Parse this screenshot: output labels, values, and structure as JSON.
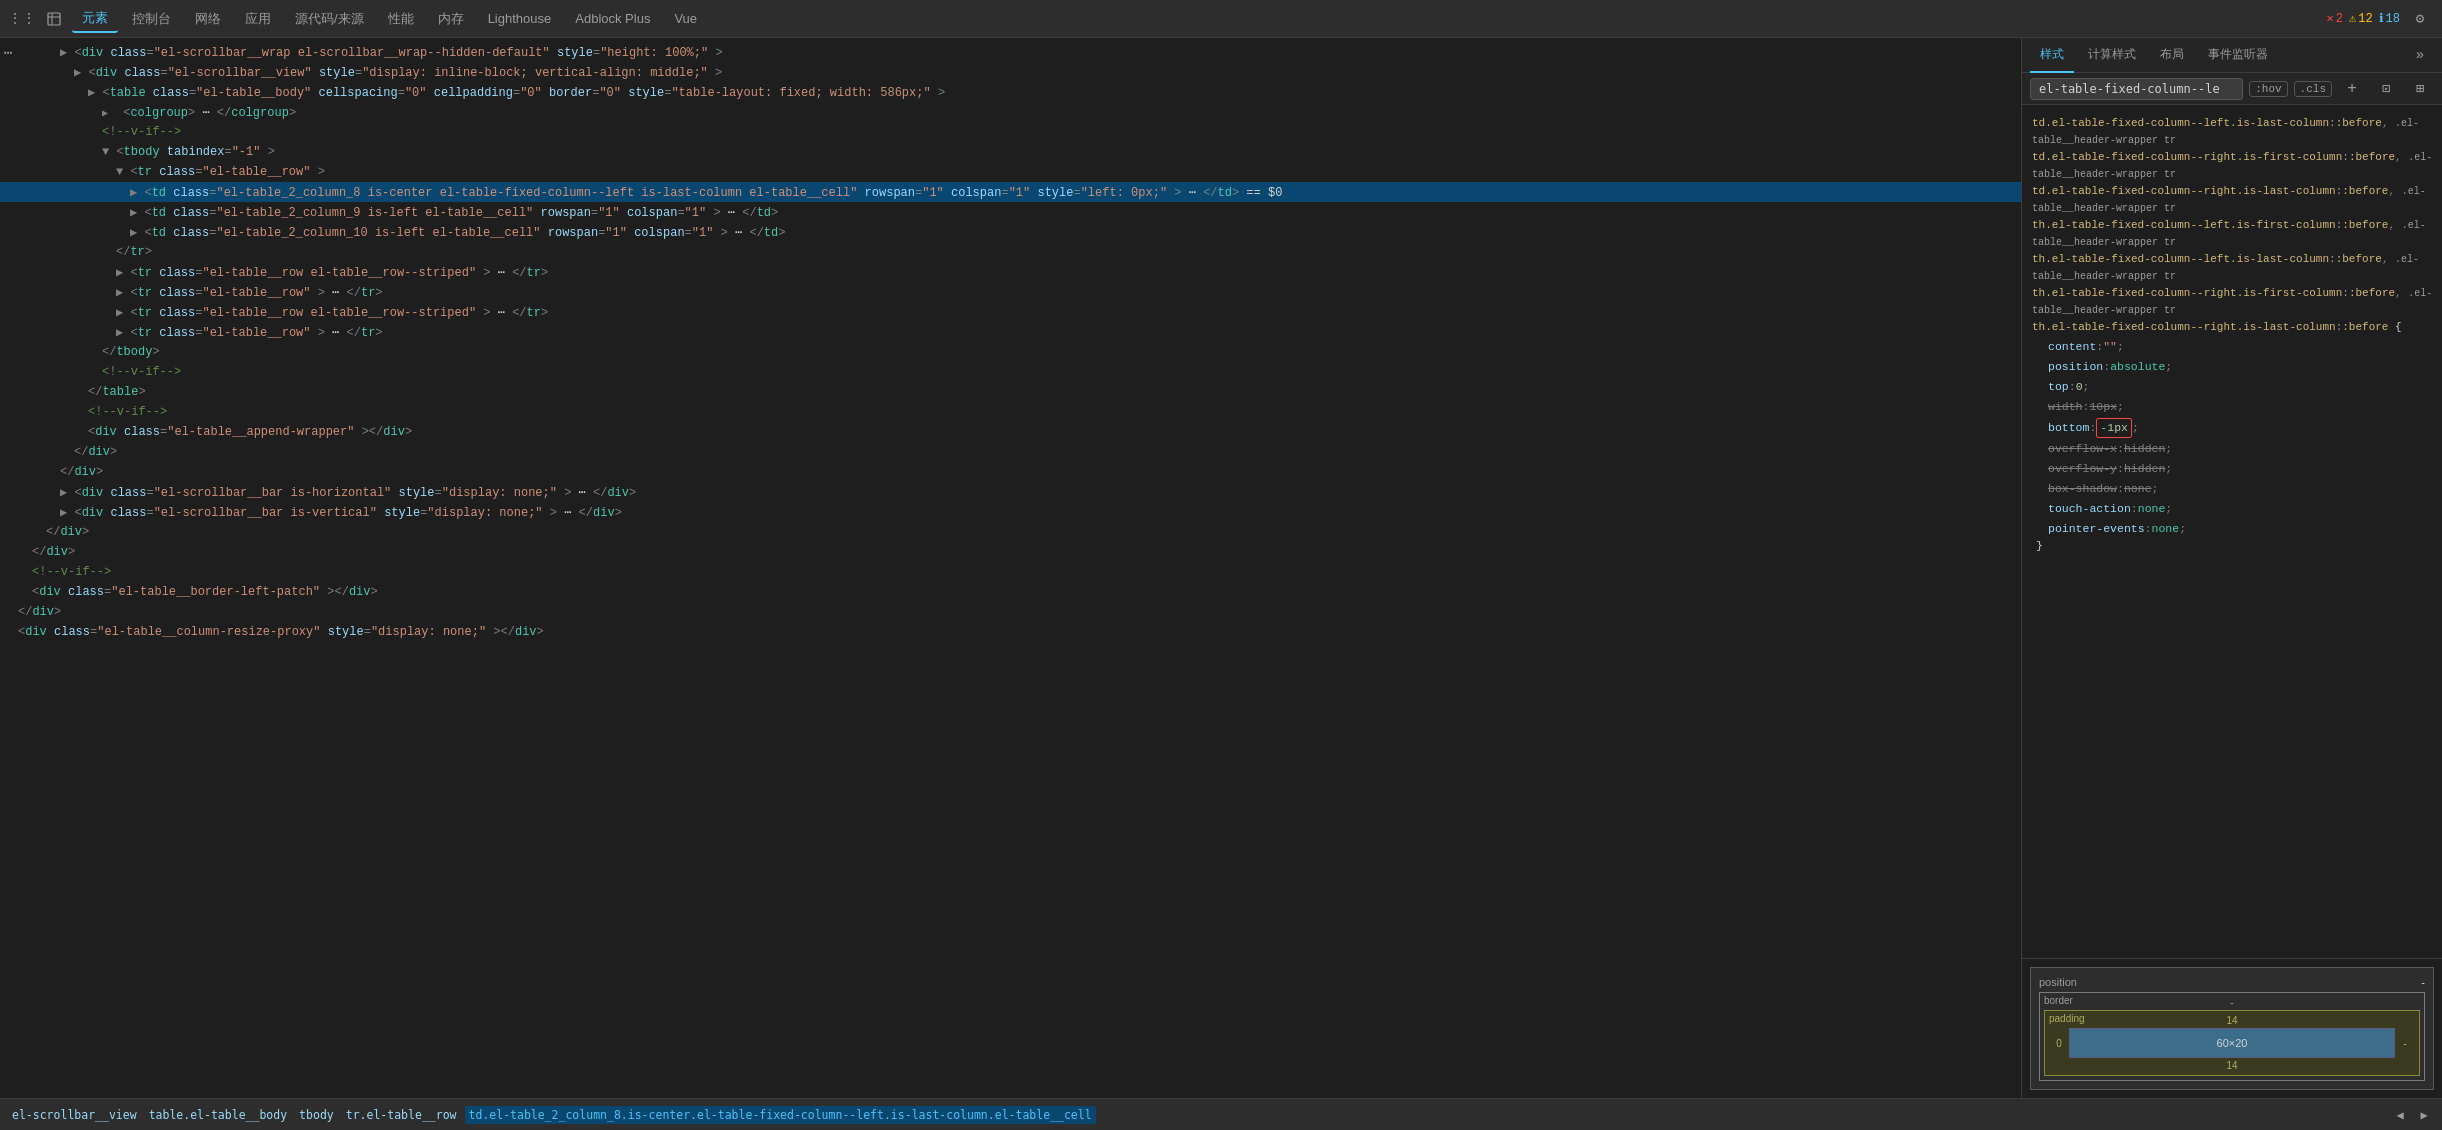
{
  "toolbar": {
    "icons": [
      "⊞",
      "☰"
    ],
    "tabs": [
      {
        "label": "元素",
        "active": true
      },
      {
        "label": "控制台",
        "active": false
      },
      {
        "label": "网络",
        "active": false
      },
      {
        "label": "应用",
        "active": false
      },
      {
        "label": "源代码/来源",
        "active": false
      },
      {
        "label": "性能",
        "active": false
      },
      {
        "label": "内存",
        "active": false
      },
      {
        "label": "Lighthouse",
        "active": false
      },
      {
        "label": "Adblock Plus",
        "active": false
      },
      {
        "label": "Vue",
        "active": false
      }
    ],
    "badge_error": "2",
    "badge_warning": "12",
    "badge_info": "18"
  },
  "dom_lines": [
    {
      "indent": 0,
      "html": "<span class='tag-bracket'>▶</span><span class='tag-bracket'>&lt;</span><span class='tag-name'>div</span> <span class='attr-name'>class</span><span class='tag-bracket'>=</span><span class='attr-value'>\"el-scrollbar__wrap el-scrollbar__wrap--hidden-default\"</span> <span class='attr-name'>style</span><span class='tag-bracket'>=</span><span class='attr-value'>\"height: 100%;\"</span> <span class='tag-bracket'>&gt;</span>",
      "depth": 4
    },
    {
      "indent": 1,
      "html": "<span class='tag-bracket'>▶</span><span class='tag-bracket'>&lt;</span><span class='tag-name'>div</span> <span class='attr-name'>class</span><span class='tag-bracket'>=</span><span class='attr-value'>\"el-scrollbar__view\"</span> <span class='attr-name'>style</span><span class='tag-bracket'>=</span><span class='attr-value'>\"display: inline-block; vertical-align: middle;\"</span><span class='tag-bracket'>&gt;</span>",
      "depth": 5
    },
    {
      "indent": 2,
      "html": "<span class='tag-bracket'>▶</span><span class='tag-bracket'>&lt;</span><span class='tag-name'>table</span> <span class='attr-name'>class</span><span class='tag-bracket'>=</span><span class='attr-value'>\"el-table__body\"</span> <span class='attr-name'>cellspacing</span><span class='tag-bracket'>=</span><span class='attr-value'>\"0\"</span> <span class='attr-name'>cellpadding</span><span class='tag-bracket'>=</span><span class='attr-value'>\"0\"</span> <span class='attr-name'>border</span><span class='tag-bracket'>=</span><span class='attr-value'>\"0\"</span> <span class='attr-name'>style</span><span class='tag-bracket'>=</span><span class='attr-value'>\"table-layout: fixed; width: 586px;\"</span><span class='tag-bracket'>&gt;</span>",
      "depth": 6
    },
    {
      "indent": 3,
      "html": "<span class='expand-arrow'>▶</span><span class='tag-bracket'>&lt;</span><span class='tag-name'>colgroup</span><span class='tag-bracket'>&gt;</span><span class='text-node'>⋯</span><span class='tag-bracket'>&lt;/</span><span class='tag-name'>colgroup</span><span class='tag-bracket'>&gt;</span>",
      "depth": 7
    },
    {
      "indent": 3,
      "html": "<span class='comment'>&lt;!--v-if--&gt;</span>",
      "depth": 7
    },
    {
      "indent": 3,
      "html": "<span class='tag-bracket'>▼</span><span class='tag-bracket'>&lt;</span><span class='tag-name'>tbody</span> <span class='attr-name'>tabindex</span><span class='tag-bracket'>=</span><span class='attr-value'>\"-1\"</span><span class='tag-bracket'>&gt;</span>",
      "depth": 7
    },
    {
      "indent": 4,
      "html": "<span class='tag-bracket'>▼</span><span class='tag-bracket'>&lt;</span><span class='tag-name'>tr</span> <span class='attr-name'>class</span><span class='tag-bracket'>=</span><span class='attr-value'>\"el-table__row\"</span><span class='tag-bracket'>&gt;</span>",
      "depth": 8
    },
    {
      "indent": 5,
      "html": "<span class='tag-bracket'>▶</span><span class='tag-bracket'>&lt;</span><span class='tag-name'>td</span> <span class='attr-name'>class</span><span class='tag-bracket'>=</span><span class='attr-value'>\"el-table_2_column_8 is-center el-table-fixed-column--left is-last-column el-table__cell\"</span> <span class='attr-name'>rowspan</span><span class='tag-bracket'>=</span><span class='attr-value'>\"1\"</span> <span class='attr-name'>colspan</span><span class='tag-bracket'>=</span><span class='attr-value'>\"1\"</span> <span class='attr-name'>style</span><span class='tag-bracket'>=</span><span class='attr-value'>\"left: 0px;\"</span><span class='tag-bracket'>&gt;</span><span class='text-node'>⋯</span><span class='tag-bracket'>&lt;/</span><span class='tag-name'>td</span><span class='tag-bracket'>&gt;</span> <span class='text-node'>== $0</span>",
      "depth": 9,
      "selected": true
    },
    {
      "indent": 5,
      "html": "<span class='tag-bracket'>▶</span><span class='tag-bracket'>&lt;</span><span class='tag-name'>td</span> <span class='attr-name'>class</span><span class='tag-bracket'>=</span><span class='attr-value'>\"el-table_2_column_9 is-left el-table__cell\"</span> <span class='attr-name'>rowspan</span><span class='tag-bracket'>=</span><span class='attr-value'>\"1\"</span> <span class='attr-name'>colspan</span><span class='tag-bracket'>=</span><span class='attr-value'>\"1\"</span><span class='tag-bracket'>&gt;</span><span class='text-node'>⋯</span><span class='tag-bracket'>&lt;/</span><span class='tag-name'>td</span><span class='tag-bracket'>&gt;</span>",
      "depth": 9
    },
    {
      "indent": 5,
      "html": "<span class='tag-bracket'>▶</span><span class='tag-bracket'>&lt;</span><span class='tag-name'>td</span> <span class='attr-name'>class</span><span class='tag-bracket'>=</span><span class='attr-value'>\"el-table_2_column_10 is-left el-table__cell\"</span> <span class='attr-name'>rowspan</span><span class='tag-bracket'>=</span><span class='attr-value'>\"1\"</span> <span class='attr-name'>colspan</span><span class='tag-bracket'>=</span><span class='attr-value'>\"1\"</span><span class='tag-bracket'>&gt;</span><span class='text-node'>⋯</span><span class='tag-bracket'>&lt;/</span><span class='tag-name'>td</span><span class='tag-bracket'>&gt;</span>",
      "depth": 9
    },
    {
      "indent": 4,
      "html": "<span class='tag-bracket'>&lt;/</span><span class='tag-name'>tr</span><span class='tag-bracket'>&gt;</span>",
      "depth": 8
    },
    {
      "indent": 4,
      "html": "<span class='tag-bracket'>▶</span><span class='tag-bracket'>&lt;</span><span class='tag-name'>tr</span> <span class='attr-name'>class</span><span class='tag-bracket'>=</span><span class='attr-value'>\"el-table__row el-table__row--striped\"</span><span class='tag-bracket'>&gt;</span><span class='text-node'>⋯</span><span class='tag-bracket'>&lt;/</span><span class='tag-name'>tr</span><span class='tag-bracket'>&gt;</span>",
      "depth": 8
    },
    {
      "indent": 4,
      "html": "<span class='tag-bracket'>▶</span><span class='tag-bracket'>&lt;</span><span class='tag-name'>tr</span> <span class='attr-name'>class</span><span class='tag-bracket'>=</span><span class='attr-value'>\"el-table__row\"</span><span class='tag-bracket'>&gt;</span><span class='text-node'>⋯</span><span class='tag-bracket'>&lt;/</span><span class='tag-name'>tr</span><span class='tag-bracket'>&gt;</span>",
      "depth": 8
    },
    {
      "indent": 4,
      "html": "<span class='tag-bracket'>▶</span><span class='tag-bracket'>&lt;</span><span class='tag-name'>tr</span> <span class='attr-name'>class</span><span class='tag-bracket'>=</span><span class='attr-value'>\"el-table__row el-table__row--striped\"</span><span class='tag-bracket'>&gt;</span><span class='text-node'>⋯</span><span class='tag-bracket'>&lt;/</span><span class='tag-name'>tr</span><span class='tag-bracket'>&gt;</span>",
      "depth": 8
    },
    {
      "indent": 4,
      "html": "<span class='tag-bracket'>▶</span><span class='tag-bracket'>&lt;</span><span class='tag-name'>tr</span> <span class='attr-name'>class</span><span class='tag-bracket'>=</span><span class='attr-value'>\"el-table__row\"</span><span class='tag-bracket'>&gt;</span><span class='text-node'>⋯</span><span class='tag-bracket'>&lt;/</span><span class='tag-name'>tr</span><span class='tag-bracket'>&gt;</span>",
      "depth": 8
    },
    {
      "indent": 3,
      "html": "<span class='tag-bracket'>&lt;/</span><span class='tag-name'>tbody</span><span class='tag-bracket'>&gt;</span>",
      "depth": 7
    },
    {
      "indent": 3,
      "html": "<span class='comment'>&lt;!--v-if--&gt;</span>",
      "depth": 7
    },
    {
      "indent": 2,
      "html": "<span class='tag-bracket'>&lt;/</span><span class='tag-name'>table</span><span class='tag-bracket'>&gt;</span>",
      "depth": 6
    },
    {
      "indent": 2,
      "html": "<span class='comment'>&lt;!--v-if--&gt;</span>",
      "depth": 6
    },
    {
      "indent": 2,
      "html": "<span class='tag-bracket'>&lt;</span><span class='tag-name'>div</span> <span class='attr-name'>class</span><span class='tag-bracket'>=</span><span class='attr-value'>\"el-table__append-wrapper\"</span><span class='tag-bracket'>&gt;&lt;/</span><span class='tag-name'>div</span><span class='tag-bracket'>&gt;</span>",
      "depth": 6
    },
    {
      "indent": 1,
      "html": "<span class='tag-bracket'>&lt;/</span><span class='tag-name'>div</span><span class='tag-bracket'>&gt;</span>",
      "depth": 5
    },
    {
      "indent": 0,
      "html": "<span class='tag-bracket'>&lt;/</span><span class='tag-name'>div</span><span class='tag-bracket'>&gt;</span>",
      "depth": 4
    },
    {
      "indent": 0,
      "html": "<span class='tag-bracket'>▶</span><span class='tag-bracket'>&lt;</span><span class='tag-name'>div</span> <span class='attr-name'>class</span><span class='tag-bracket'>=</span><span class='attr-value'>\"el-scrollbar__bar is-horizontal\"</span> <span class='attr-name'>style</span><span class='tag-bracket'>=</span><span class='attr-value'>\"display: none;\"</span><span class='tag-bracket'>&gt;</span><span class='text-node'>⋯</span><span class='tag-bracket'>&lt;/</span><span class='tag-name'>div</span><span class='tag-bracket'>&gt;</span>",
      "depth": 4
    },
    {
      "indent": 0,
      "html": "<span class='tag-bracket'>▶</span><span class='tag-bracket'>&lt;</span><span class='tag-name'>div</span> <span class='attr-name'>class</span><span class='tag-bracket'>=</span><span class='attr-value'>\"el-scrollbar__bar is-vertical\"</span> <span class='attr-name'>style</span><span class='tag-bracket'>=</span><span class='attr-value'>\"display: none;\"</span><span class='tag-bracket'>&gt;</span><span class='text-node'>⋯</span><span class='tag-bracket'>&lt;/</span><span class='tag-name'>div</span><span class='tag-bracket'>&gt;</span>",
      "depth": 4
    },
    {
      "indent": -1,
      "html": "<span class='tag-bracket'>&lt;/</span><span class='tag-name'>div</span><span class='tag-bracket'>&gt;</span>",
      "depth": 3
    },
    {
      "indent": -2,
      "html": "<span class='tag-bracket'>&lt;/</span><span class='tag-name'>div</span><span class='tag-bracket'>&gt;</span>",
      "depth": 2
    },
    {
      "indent": -2,
      "html": "<span class='comment'>&lt;!--v-if--&gt;</span>",
      "depth": 2
    },
    {
      "indent": -2,
      "html": "<span class='tag-bracket'>&lt;</span><span class='tag-name'>div</span> <span class='attr-name'>class</span><span class='tag-bracket'>=</span><span class='attr-value'>\"el-table__border-left-patch\"</span><span class='tag-bracket'>&gt;&lt;/</span><span class='tag-name'>div</span><span class='tag-bracket'>&gt;</span>",
      "depth": 2
    },
    {
      "indent": -3,
      "html": "<span class='tag-bracket'>&lt;/</span><span class='tag-name'>div</span><span class='tag-bracket'>&gt;</span>",
      "depth": 1
    },
    {
      "indent": -3,
      "html": "<span class='tag-bracket'>&lt;</span><span class='tag-name'>div</span> <span class='attr-name'>class</span><span class='tag-bracket'>=</span><span class='attr-value'>\"el-table__column-resize-proxy\"</span> <span class='attr-name'>style</span><span class='tag-bracket'>=</span><span class='attr-value'>\"display: none;\"</span><span class='tag-bracket'>&gt;&lt;/</span><span class='tag-name'>div</span><span class='tag-bracket'>&gt;</span>",
      "depth": 1
    }
  ],
  "styles_panel": {
    "tabs": [
      "样式",
      "计算样式",
      "布局",
      "事件监听器"
    ],
    "more_icon": "»",
    "filter_value": "el-table-fixed-column--le",
    "filter_badges": [
      ":hov",
      ".cls"
    ],
    "add_icon": "+",
    "toggle_icon": "⊡",
    "expand_icon": "⊞",
    "selectors": [
      {
        "selector": "td.el-table-fixed-column--left.is-last-column::before,",
        "selector2": ".el-table__header-wrapper tr",
        "selector3": "td.el-table-fixed-column--right.is-first-column::before,",
        "selector4": ".el-table__header-wrapper tr",
        "selector5": "td.el-table-fixed-column--right.is-last-column::before,",
        "selector6": ".el-table__header-wrapper tr",
        "selector7": "th.el-table-fixed-column--left.is-first-column::before,",
        "selector8": ".el-table__header-wrapper tr",
        "selector9": "th.el-table-fixed-column--left.is-last-column::before,",
        "selector10": ".el-table__header-wrapper tr",
        "selector11": "th.el-table-fixed-column--right.is-first-column::before,",
        "selector12": ".el-table__header-wrapper tr",
        "selector13": "th.el-table-fixed-column--right.is-last-column::before {",
        "properties": [
          {
            "prop": "content",
            "val": "\"\"",
            "strikethrough": false
          },
          {
            "prop": "position",
            "val": "absolute",
            "strikethrough": false
          },
          {
            "prop": "top",
            "val": "0",
            "strikethrough": false
          },
          {
            "prop": "width",
            "val": "10px",
            "strikethrough": true
          },
          {
            "prop": "bottom",
            "val": "-1px",
            "strikethrough": false,
            "highlighted": true
          },
          {
            "prop": "overflow-x",
            "val": "hidden",
            "strikethrough": true
          },
          {
            "prop": "overflow-y",
            "val": "hidden",
            "strikethrough": true
          },
          {
            "prop": "box-shadow",
            "val": "none",
            "strikethrough": true
          },
          {
            "prop": "touch-action",
            "val": "none",
            "strikethrough": false
          },
          {
            "prop": "pointer-events",
            "val": "none",
            "strikethrough": false
          }
        ]
      }
    ]
  },
  "box_model": {
    "position_label": "position",
    "position_val": "-",
    "border_label": "border",
    "border_val": "-",
    "padding_label": "padding",
    "padding_val": "14",
    "content_val": "60×20",
    "padding_bottom": "14",
    "left_val": "0",
    "right_val": "-"
  },
  "breadcrumb": {
    "items": [
      {
        "label": "el-scrollbar__view",
        "active": false
      },
      {
        "label": "table.el-table__body",
        "active": false
      },
      {
        "label": "tbody",
        "active": false
      },
      {
        "label": "tr.el-table__row",
        "active": false
      },
      {
        "label": "td.el-table_2_column_8.is-center.el-table-fixed-column--left.is-last-column.el-table__cell",
        "active": true
      }
    ],
    "nav_prev": "◀",
    "nav_next": "▶"
  }
}
